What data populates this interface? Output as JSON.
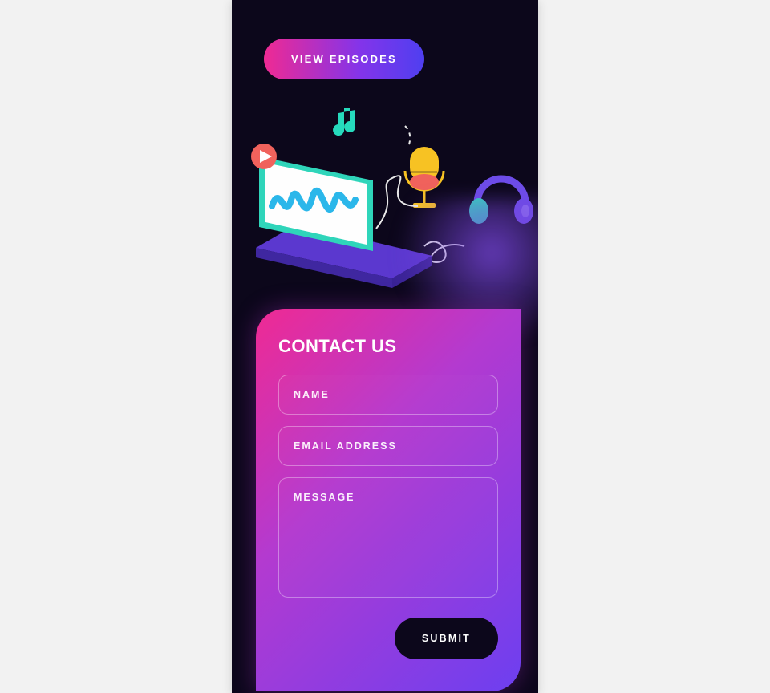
{
  "cta": {
    "label": "VIEW EPISODES"
  },
  "contact": {
    "title": "CONTACT US",
    "name_placeholder": "NAME",
    "email_placeholder": "EMAIL ADDRESS",
    "message_placeholder": "MESSAGE",
    "submit_label": "SUBMIT"
  },
  "icons": {
    "music_note": "music-note-icon",
    "play": "play-icon",
    "laptop": "laptop-icon",
    "waveform": "waveform-icon",
    "microphone": "microphone-icon",
    "headphones": "headphones-icon"
  }
}
